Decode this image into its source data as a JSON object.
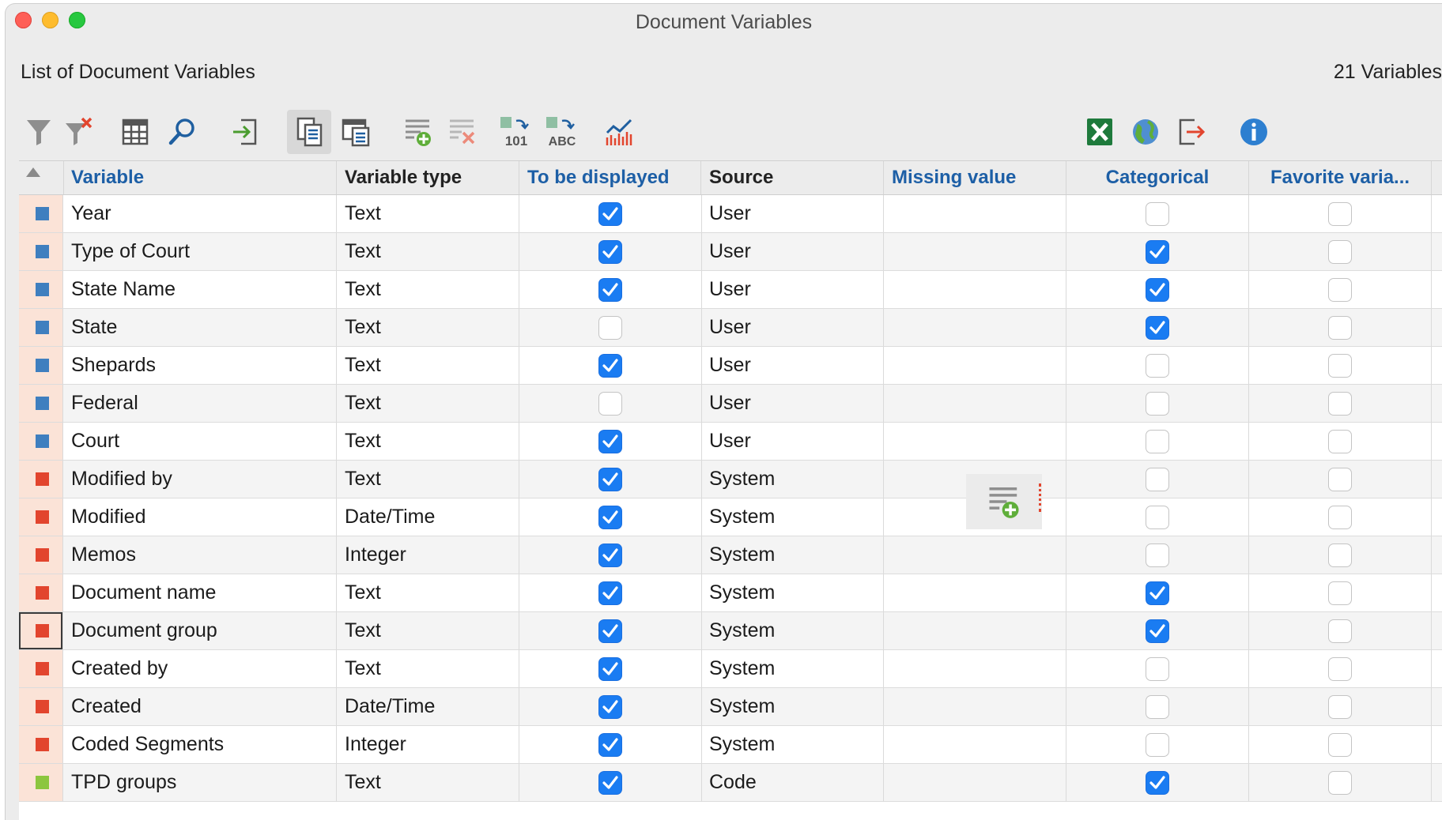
{
  "window": {
    "title": "Document Variables"
  },
  "panel": {
    "heading": "List of Document Variables",
    "count": "21 Variables"
  },
  "toolbar": {
    "buttons": [
      {
        "name": "filter-icon"
      },
      {
        "name": "clear-filter-icon"
      },
      {
        "name": "columns-icon"
      },
      {
        "name": "search-icon"
      },
      {
        "name": "import-icon"
      },
      {
        "name": "list-view-icon",
        "active": true
      },
      {
        "name": "data-editor-icon"
      },
      {
        "name": "add-variable-icon"
      },
      {
        "name": "delete-variable-icon"
      },
      {
        "name": "convert-to-number-icon"
      },
      {
        "name": "convert-to-text-icon"
      },
      {
        "name": "statistics-icon"
      },
      {
        "name": "excel-export-icon"
      },
      {
        "name": "globe-export-icon"
      },
      {
        "name": "export-icon"
      },
      {
        "name": "info-icon"
      }
    ],
    "glyph_101": "101",
    "glyph_abc": "ABC"
  },
  "table": {
    "columns": [
      "Variable",
      "Variable type",
      "To be displayed",
      "Source",
      "Missing value",
      "Categorical",
      "Favorite varia..."
    ],
    "rows": [
      {
        "variable": "Year",
        "type": "Text",
        "displayed": true,
        "source": "User",
        "missing": "",
        "categorical": false,
        "favorite": false,
        "kind": "user"
      },
      {
        "variable": "Type of Court",
        "type": "Text",
        "displayed": true,
        "source": "User",
        "missing": "",
        "categorical": true,
        "favorite": false,
        "kind": "user"
      },
      {
        "variable": "State Name",
        "type": "Text",
        "displayed": true,
        "source": "User",
        "missing": "",
        "categorical": true,
        "favorite": false,
        "kind": "user"
      },
      {
        "variable": "State",
        "type": "Text",
        "displayed": false,
        "source": "User",
        "missing": "",
        "categorical": true,
        "favorite": false,
        "kind": "user"
      },
      {
        "variable": "Shepards",
        "type": "Text",
        "displayed": true,
        "source": "User",
        "missing": "",
        "categorical": false,
        "favorite": false,
        "kind": "user"
      },
      {
        "variable": "Federal",
        "type": "Text",
        "displayed": false,
        "source": "User",
        "missing": "",
        "categorical": false,
        "favorite": false,
        "kind": "user"
      },
      {
        "variable": "Court",
        "type": "Text",
        "displayed": true,
        "source": "User",
        "missing": "",
        "categorical": false,
        "favorite": false,
        "kind": "user"
      },
      {
        "variable": "Modified by",
        "type": "Text",
        "displayed": true,
        "source": "System",
        "missing": "",
        "categorical": false,
        "favorite": false,
        "kind": "system"
      },
      {
        "variable": "Modified",
        "type": "Date/Time",
        "displayed": true,
        "source": "System",
        "missing": "",
        "categorical": false,
        "favorite": false,
        "kind": "system"
      },
      {
        "variable": "Memos",
        "type": "Integer",
        "displayed": true,
        "source": "System",
        "missing": "",
        "categorical": false,
        "favorite": false,
        "kind": "system"
      },
      {
        "variable": "Document name",
        "type": "Text",
        "displayed": true,
        "source": "System",
        "missing": "",
        "categorical": true,
        "favorite": false,
        "kind": "system"
      },
      {
        "variable": "Document group",
        "type": "Text",
        "displayed": true,
        "source": "System",
        "missing": "",
        "categorical": true,
        "favorite": false,
        "kind": "system",
        "focused": true
      },
      {
        "variable": "Created by",
        "type": "Text",
        "displayed": true,
        "source": "System",
        "missing": "",
        "categorical": false,
        "favorite": false,
        "kind": "system"
      },
      {
        "variable": "Created",
        "type": "Date/Time",
        "displayed": true,
        "source": "System",
        "missing": "",
        "categorical": false,
        "favorite": false,
        "kind": "system"
      },
      {
        "variable": "Coded Segments",
        "type": "Integer",
        "displayed": true,
        "source": "System",
        "missing": "",
        "categorical": false,
        "favorite": false,
        "kind": "system"
      },
      {
        "variable": "TPD groups",
        "type": "Text",
        "displayed": true,
        "source": "Code",
        "missing": "",
        "categorical": true,
        "favorite": false,
        "kind": "code"
      }
    ]
  },
  "colors": {
    "user": "#3f7fbf",
    "system": "#e2452e",
    "code": "#8cc63f",
    "accent": "#1a7cf2"
  },
  "drag_ghost": {
    "icon": "add-variable-icon"
  }
}
